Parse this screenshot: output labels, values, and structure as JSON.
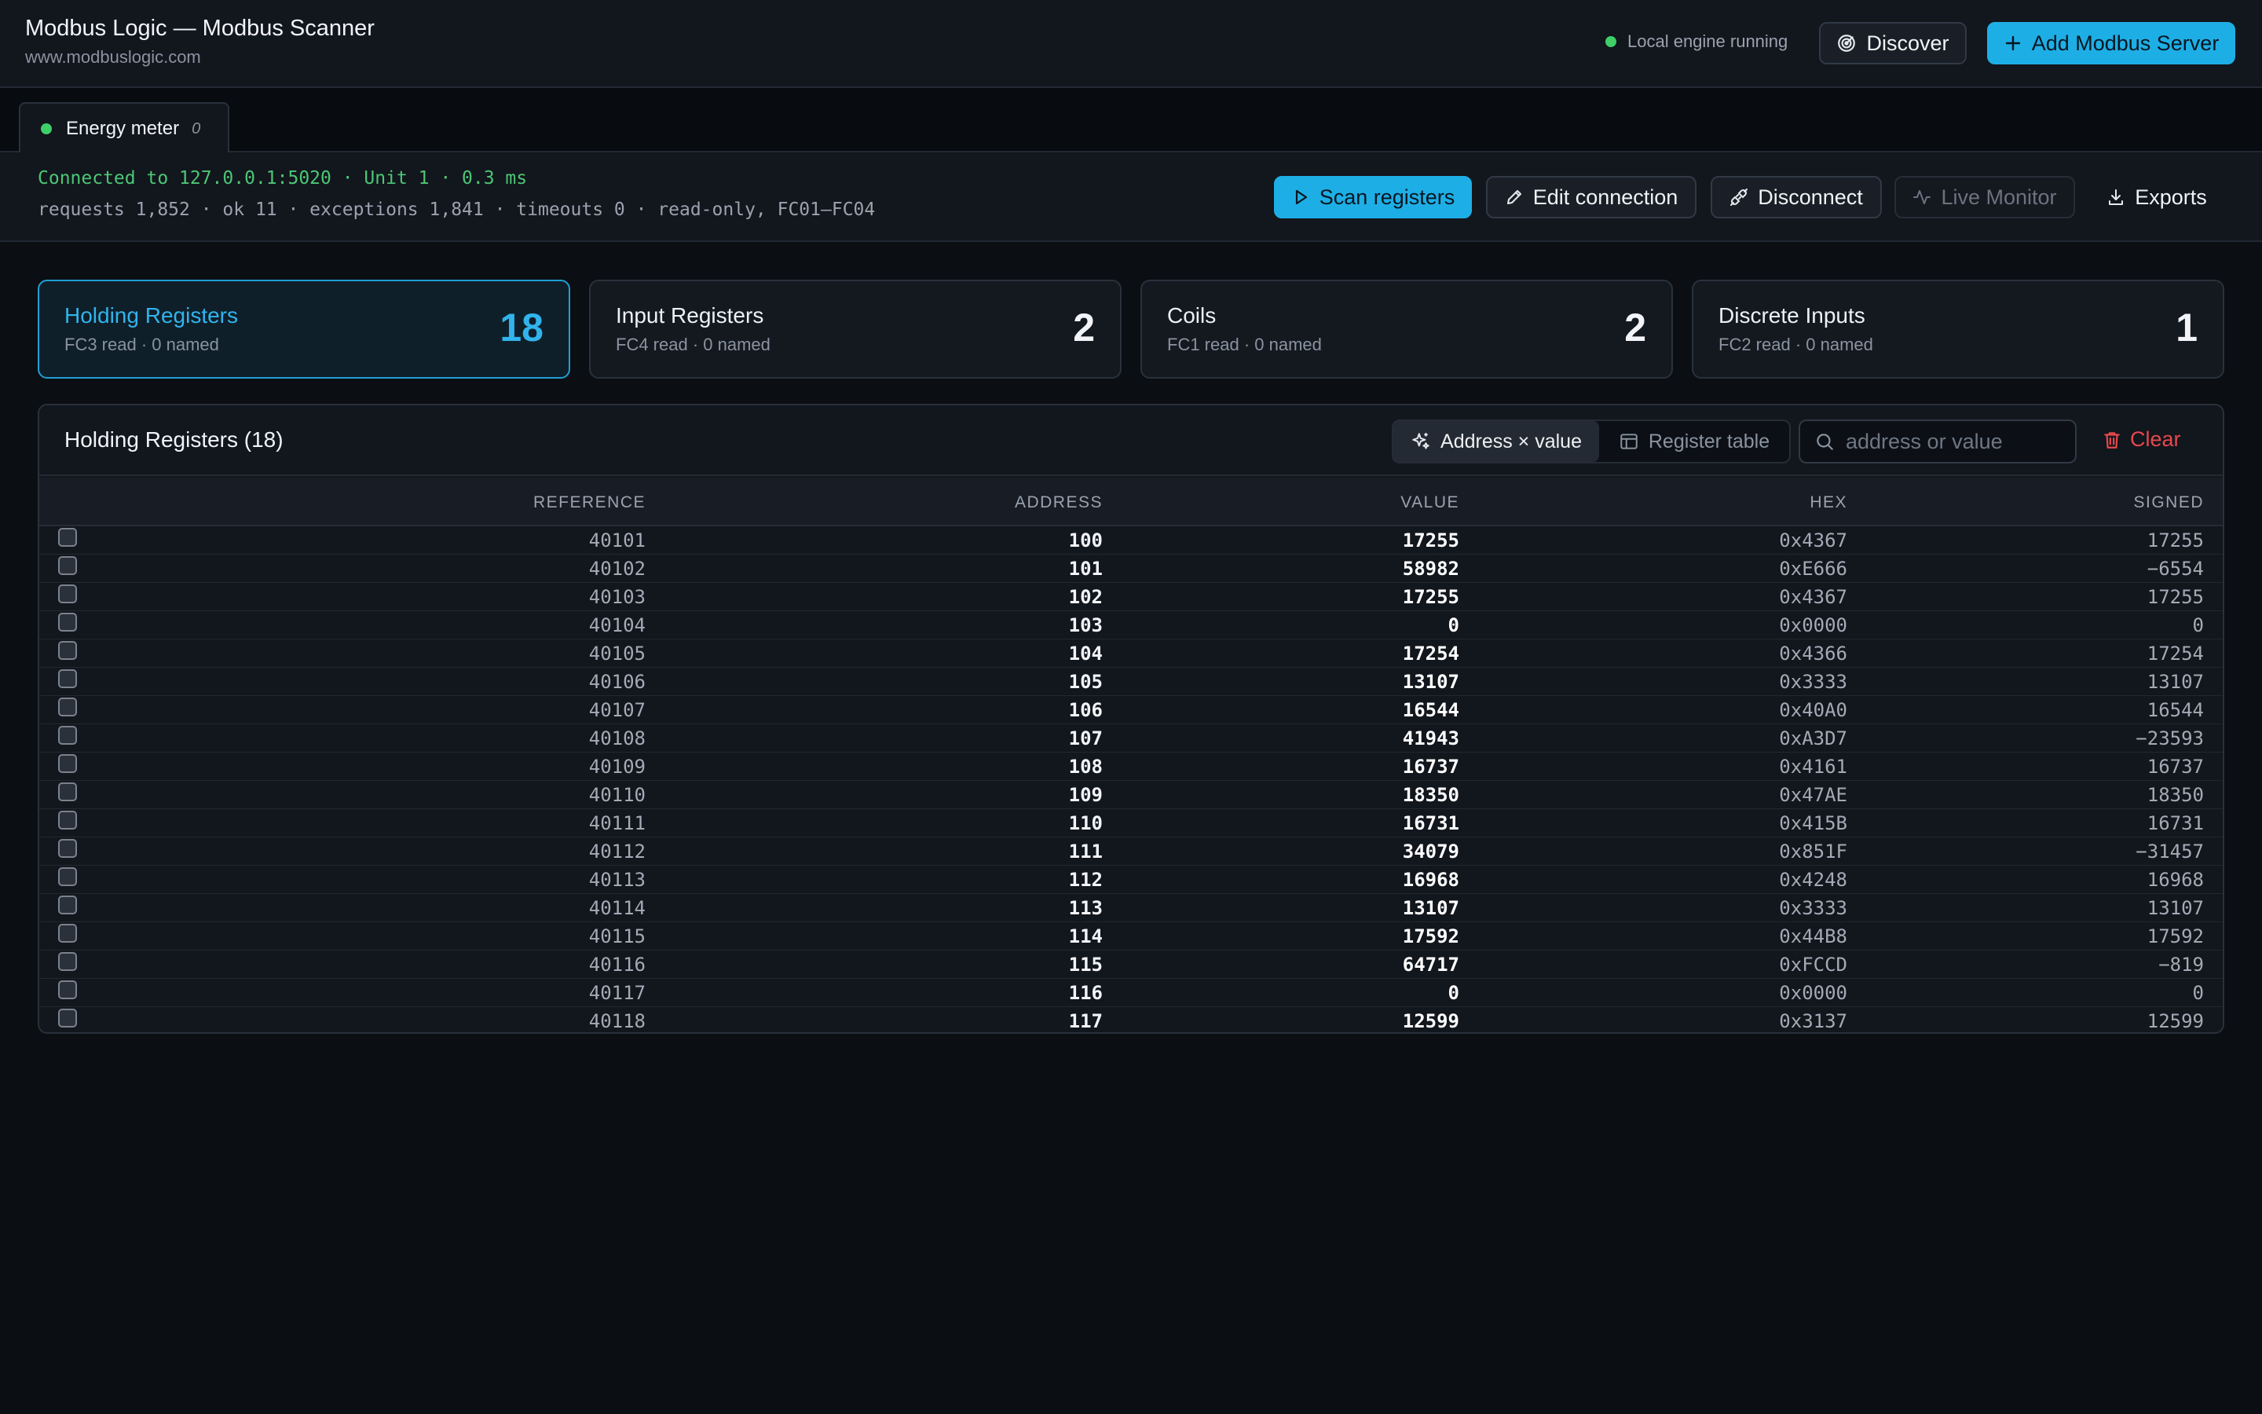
{
  "header": {
    "title": "Modbus Logic — Modbus Scanner",
    "subtitle": "www.modbuslogic.com",
    "engine_status": "Local engine running",
    "discover_label": "Discover",
    "add_server_label": "Add Modbus Server"
  },
  "tabs": [
    {
      "label": "Energy meter",
      "count": "0",
      "status_color": "#3fcf68"
    }
  ],
  "connection": {
    "line1": "Connected to 127.0.0.1:5020 · Unit 1 · 0.3 ms",
    "line2": "requests 1,852 · ok 11 · exceptions 1,841 · timeouts 0 · read-only, FC01–FC04",
    "actions": {
      "scan": "Scan registers",
      "edit": "Edit connection",
      "disconnect": "Disconnect",
      "live_monitor": "Live Monitor",
      "exports": "Exports"
    }
  },
  "cards": [
    {
      "title": "Holding Registers",
      "sub": "FC3 read · 0 named",
      "count": "18"
    },
    {
      "title": "Input Registers",
      "sub": "FC4 read · 0 named",
      "count": "2"
    },
    {
      "title": "Coils",
      "sub": "FC1 read · 0 named",
      "count": "2"
    },
    {
      "title": "Discrete Inputs",
      "sub": "FC2 read · 0 named",
      "count": "1"
    }
  ],
  "table": {
    "title": "Holding Registers (18)",
    "view_toggle": {
      "address_value": "Address × value",
      "register_table": "Register table"
    },
    "search_placeholder": "address or value",
    "clear_label": "Clear",
    "columns": [
      "REFERENCE",
      "ADDRESS",
      "VALUE",
      "HEX",
      "SIGNED"
    ],
    "rows": [
      [
        "40101",
        "100",
        "17255",
        "0x4367",
        "17255"
      ],
      [
        "40102",
        "101",
        "58982",
        "0xE666",
        "−6554"
      ],
      [
        "40103",
        "102",
        "17255",
        "0x4367",
        "17255"
      ],
      [
        "40104",
        "103",
        "0",
        "0x0000",
        "0"
      ],
      [
        "40105",
        "104",
        "17254",
        "0x4366",
        "17254"
      ],
      [
        "40106",
        "105",
        "13107",
        "0x3333",
        "13107"
      ],
      [
        "40107",
        "106",
        "16544",
        "0x40A0",
        "16544"
      ],
      [
        "40108",
        "107",
        "41943",
        "0xA3D7",
        "−23593"
      ],
      [
        "40109",
        "108",
        "16737",
        "0x4161",
        "16737"
      ],
      [
        "40110",
        "109",
        "18350",
        "0x47AE",
        "18350"
      ],
      [
        "40111",
        "110",
        "16731",
        "0x415B",
        "16731"
      ],
      [
        "40112",
        "111",
        "34079",
        "0x851F",
        "−31457"
      ],
      [
        "40113",
        "112",
        "16968",
        "0x4248",
        "16968"
      ],
      [
        "40114",
        "113",
        "13107",
        "0x3333",
        "13107"
      ],
      [
        "40115",
        "114",
        "17592",
        "0x44B8",
        "17592"
      ],
      [
        "40116",
        "115",
        "64717",
        "0xFCCD",
        "−819"
      ],
      [
        "40117",
        "116",
        "0",
        "0x0000",
        "0"
      ],
      [
        "40118",
        "117",
        "12599",
        "0x3137",
        "12599"
      ]
    ]
  }
}
